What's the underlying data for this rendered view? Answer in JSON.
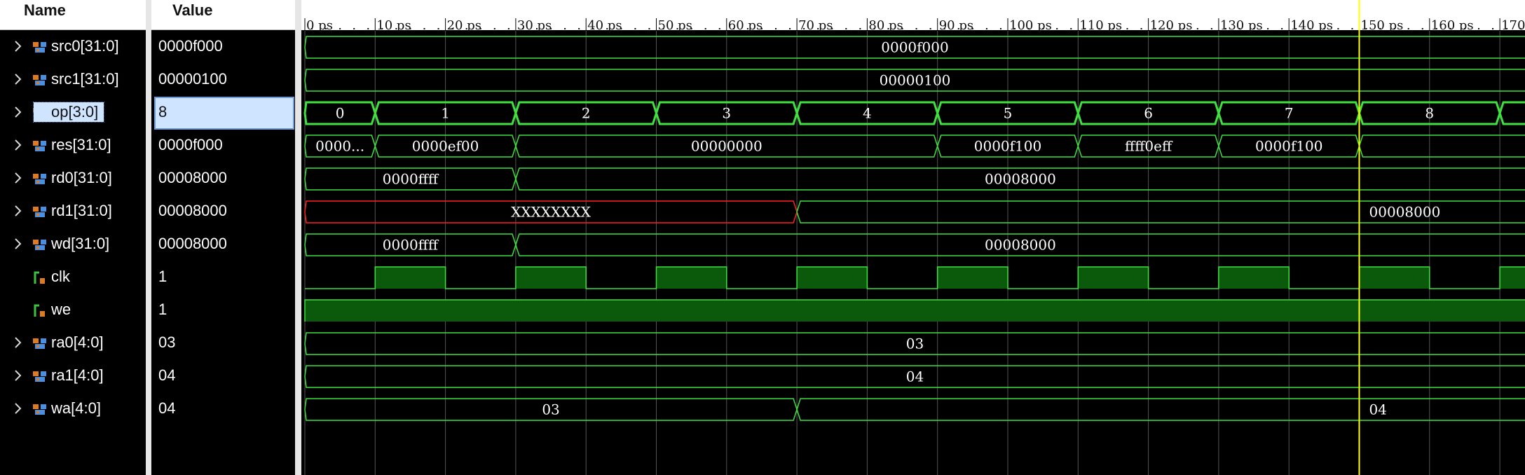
{
  "headers": {
    "name": "Name",
    "value": "Value"
  },
  "signals": [
    {
      "name": "src0[31:0]",
      "value": "0000f000",
      "icon": "bus-icon",
      "bus": true
    },
    {
      "name": "src1[31:0]",
      "value": "00000100",
      "icon": "bus-icon",
      "bus": true
    },
    {
      "name": "op[3:0]",
      "value": "8",
      "icon": "bus-icon",
      "bus": true,
      "selected": true
    },
    {
      "name": "res[31:0]",
      "value": "0000f000",
      "icon": "bus-icon",
      "bus": true
    },
    {
      "name": "rd0[31:0]",
      "value": "00008000",
      "icon": "bus-icon",
      "bus": true
    },
    {
      "name": "rd1[31:0]",
      "value": "00008000",
      "icon": "bus-icon",
      "bus": true
    },
    {
      "name": "wd[31:0]",
      "value": "00008000",
      "icon": "bus-icon",
      "bus": true
    },
    {
      "name": "clk",
      "value": "1",
      "icon": "bit-icon",
      "bus": false
    },
    {
      "name": "we",
      "value": "1",
      "icon": "bit-icon",
      "bus": false
    },
    {
      "name": "ra0[4:0]",
      "value": "03",
      "icon": "bus-icon",
      "bus": true
    },
    {
      "name": "ra1[4:0]",
      "value": "04",
      "icon": "bus-icon",
      "bus": true
    },
    {
      "name": "wa[4:0]",
      "value": "04",
      "icon": "bus-icon",
      "bus": true
    }
  ],
  "timeline": {
    "ticks": [
      "0 ps",
      "10 ps",
      "20 ps",
      "30 ps",
      "40 ps",
      "50 ps",
      "60 ps",
      "70 ps",
      "80 ps",
      "90 ps",
      "100 ps",
      "110 ps",
      "120 ps",
      "130 ps",
      "140 ps",
      "150 ps",
      "160 ps",
      "170"
    ],
    "cursor_time_ps": 150,
    "colors": {
      "wave": "#3fe03f",
      "fill": "#0b5a0b",
      "undefined": "#ff2020",
      "cursor": "#ffff00",
      "grid": "#555555"
    }
  },
  "waves": [
    {
      "type": "bus",
      "segments": [
        {
          "t0": 0,
          "t1": 175,
          "label": "0000f000"
        }
      ]
    },
    {
      "type": "bus",
      "segments": [
        {
          "t0": 0,
          "t1": 175,
          "label": "00000100"
        }
      ]
    },
    {
      "type": "bus",
      "bold": true,
      "segments": [
        {
          "t0": 0,
          "t1": 10,
          "label": "0"
        },
        {
          "t0": 10,
          "t1": 30,
          "label": "1"
        },
        {
          "t0": 30,
          "t1": 50,
          "label": "2"
        },
        {
          "t0": 50,
          "t1": 70,
          "label": "3"
        },
        {
          "t0": 70,
          "t1": 90,
          "label": "4"
        },
        {
          "t0": 90,
          "t1": 110,
          "label": "5"
        },
        {
          "t0": 110,
          "t1": 130,
          "label": "6"
        },
        {
          "t0": 130,
          "t1": 150,
          "label": "7"
        },
        {
          "t0": 150,
          "t1": 170,
          "label": "8"
        },
        {
          "t0": 170,
          "t1": 175,
          "label": ""
        }
      ]
    },
    {
      "type": "bus",
      "segments": [
        {
          "t0": 0,
          "t1": 10,
          "label": "0000..."
        },
        {
          "t0": 10,
          "t1": 30,
          "label": "0000ef00"
        },
        {
          "t0": 30,
          "t1": 90,
          "label": "00000000"
        },
        {
          "t0": 90,
          "t1": 110,
          "label": "0000f100"
        },
        {
          "t0": 110,
          "t1": 130,
          "label": "ffff0eff"
        },
        {
          "t0": 130,
          "t1": 150,
          "label": "0000f100"
        },
        {
          "t0": 150,
          "t1": 175,
          "label": ""
        }
      ]
    },
    {
      "type": "bus",
      "segments": [
        {
          "t0": 0,
          "t1": 30,
          "label": "0000ffff"
        },
        {
          "t0": 30,
          "t1": 175,
          "label": "00008000"
        }
      ]
    },
    {
      "type": "bus",
      "segments": [
        {
          "t0": 0,
          "t1": 70,
          "label": "XXXXXXXX",
          "undefined": true
        },
        {
          "t0": 70,
          "t1": 175,
          "label": "00008000",
          "label_at": 151
        }
      ]
    },
    {
      "type": "bus",
      "segments": [
        {
          "t0": 0,
          "t1": 30,
          "label": "0000ffff"
        },
        {
          "t0": 30,
          "t1": 175,
          "label": "00008000"
        }
      ]
    },
    {
      "type": "clock",
      "period_ps": 20,
      "high_first_ps": 10
    },
    {
      "type": "high"
    },
    {
      "type": "bus",
      "segments": [
        {
          "t0": 0,
          "t1": 175,
          "label": "03"
        }
      ]
    },
    {
      "type": "bus",
      "segments": [
        {
          "t0": 0,
          "t1": 175,
          "label": "04"
        }
      ]
    },
    {
      "type": "bus",
      "segments": [
        {
          "t0": 0,
          "t1": 70,
          "label": "03"
        },
        {
          "t0": 70,
          "t1": 175,
          "label": "04",
          "label_at": 151
        }
      ]
    }
  ]
}
